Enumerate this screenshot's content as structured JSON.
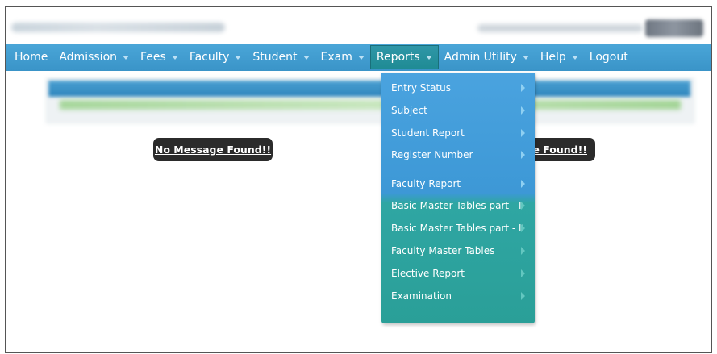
{
  "nav": {
    "items": [
      {
        "label": "Home",
        "dropdown": false
      },
      {
        "label": "Admission",
        "dropdown": true
      },
      {
        "label": "Fees",
        "dropdown": true
      },
      {
        "label": "Faculty",
        "dropdown": true
      },
      {
        "label": "Student",
        "dropdown": true
      },
      {
        "label": "Exam",
        "dropdown": true
      },
      {
        "label": "Reports",
        "dropdown": true,
        "active": true
      },
      {
        "label": "Admin Utility",
        "dropdown": true
      },
      {
        "label": "Help",
        "dropdown": true
      },
      {
        "label": "Logout",
        "dropdown": false
      }
    ]
  },
  "reports_menu": {
    "items": [
      {
        "label": "Entry Status"
      },
      {
        "label": "Subject"
      },
      {
        "label": "Student Report"
      },
      {
        "label": "Register Number"
      },
      {
        "label": "Faculty Report"
      },
      {
        "label": "Basic Master Tables part - I"
      },
      {
        "label": "Basic Master Tables part - II"
      },
      {
        "label": "Faculty Master Tables"
      },
      {
        "label": "Elective Report"
      },
      {
        "label": "Examination"
      }
    ]
  },
  "messages": {
    "left": "No Message Found!!",
    "right_visible": "le Found!!"
  },
  "colors": {
    "navbar": "#3a94c8",
    "active_tab": "#1f8b94",
    "menu_blue": "#3d98d6",
    "menu_teal": "#2a9f98",
    "badge_bg": "#2b2b2b"
  }
}
